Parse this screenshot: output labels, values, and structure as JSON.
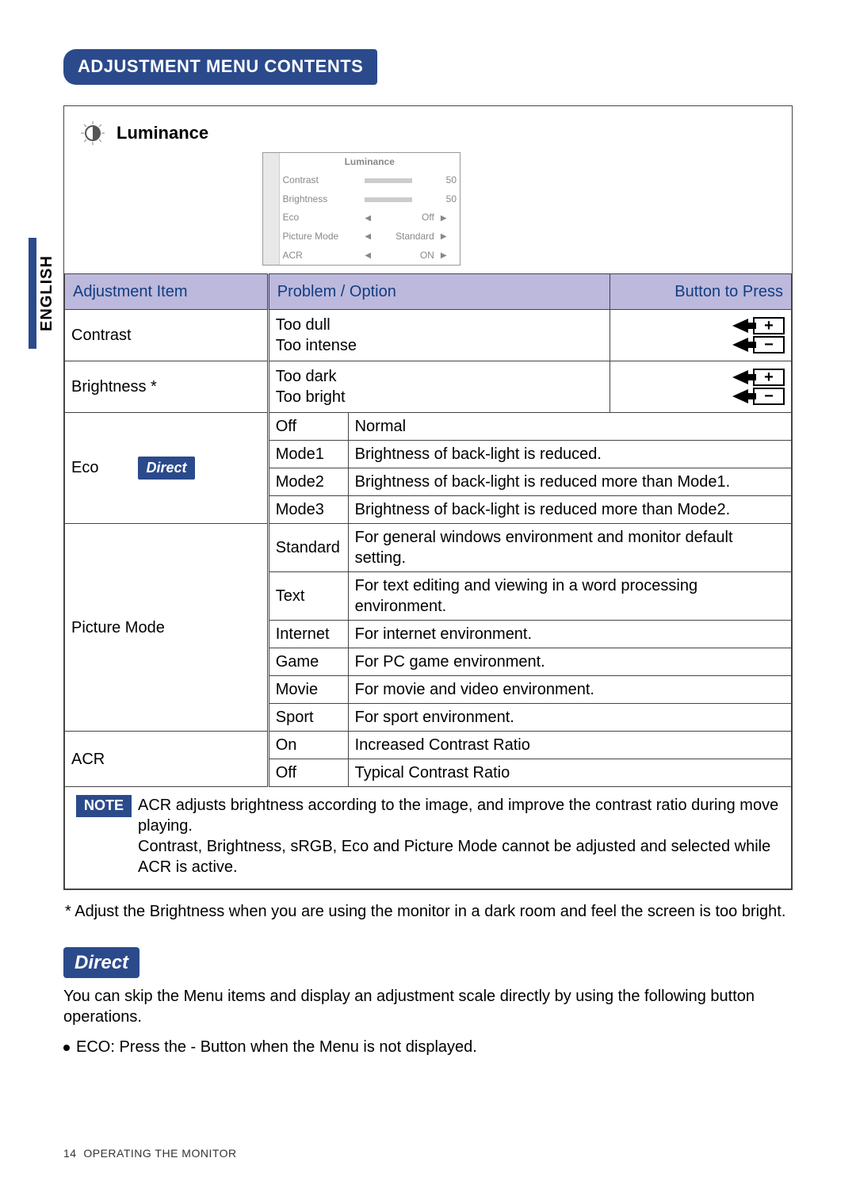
{
  "language_tab": "ENGLISH",
  "page_title": "ADJUSTMENT MENU CONTENTS",
  "section": {
    "title": "Luminance"
  },
  "osd": {
    "title": "Luminance",
    "rows": [
      {
        "label": "Contrast",
        "value": "50",
        "type": "slider"
      },
      {
        "label": "Brightness",
        "value": "50",
        "type": "slider"
      },
      {
        "label": "Eco",
        "value": "Off",
        "type": "select"
      },
      {
        "label": "Picture Mode",
        "value": "Standard",
        "type": "select"
      },
      {
        "label": "ACR",
        "value": "ON",
        "type": "select"
      }
    ]
  },
  "table": {
    "headers": {
      "item": "Adjustment Item",
      "problem": "Problem / Option",
      "button": "Button to Press"
    },
    "contrast": {
      "label": "Contrast",
      "p1": "Too dull",
      "p2": "Too intense"
    },
    "brightness": {
      "label": "Brightness *",
      "p1": "Too dark",
      "p2": "Too bright"
    },
    "eco": {
      "label": "Eco",
      "badge": "Direct",
      "rows": [
        {
          "opt": "Off",
          "desc": "Normal"
        },
        {
          "opt": "Mode1",
          "desc": "Brightness of back-light is reduced."
        },
        {
          "opt": "Mode2",
          "desc": "Brightness of back-light is reduced more than Mode1."
        },
        {
          "opt": "Mode3",
          "desc": "Brightness of back-light is reduced more than Mode2."
        }
      ]
    },
    "picture": {
      "label": "Picture Mode",
      "rows": [
        {
          "opt": "Standard",
          "desc": "For general windows environment and monitor default setting."
        },
        {
          "opt": "Text",
          "desc": "For text editing and viewing in a word processing environment."
        },
        {
          "opt": "Internet",
          "desc": "For internet environment."
        },
        {
          "opt": "Game",
          "desc": "For PC game environment."
        },
        {
          "opt": "Movie",
          "desc": "For movie and video environment."
        },
        {
          "opt": "Sport",
          "desc": "For sport environment."
        }
      ]
    },
    "acr": {
      "label": "ACR",
      "rows": [
        {
          "opt": "On",
          "desc": "Increased Contrast Ratio"
        },
        {
          "opt": "Off",
          "desc": "Typical Contrast Ratio"
        }
      ]
    }
  },
  "note": {
    "badge": "NOTE",
    "line1": "ACR adjusts brightness according to the image, and improve the contrast ratio during move playing.",
    "line2": "Contrast, Brightness, sRGB, Eco and Picture Mode cannot be adjusted and selected while ACR is active."
  },
  "footnote": "*  Adjust the Brightness when you are using the monitor in a dark room and feel the screen is too bright.",
  "direct_section": {
    "badge": "Direct",
    "text": "You can skip the Menu items and display an adjustment scale directly by using the following button operations.",
    "bullet": "ECO: Press the - Button when the Menu is not displayed."
  },
  "footer": {
    "page_num": "14",
    "text": "OPERATING THE MONITOR"
  },
  "buttons": {
    "plus": "+",
    "minus": "−"
  }
}
